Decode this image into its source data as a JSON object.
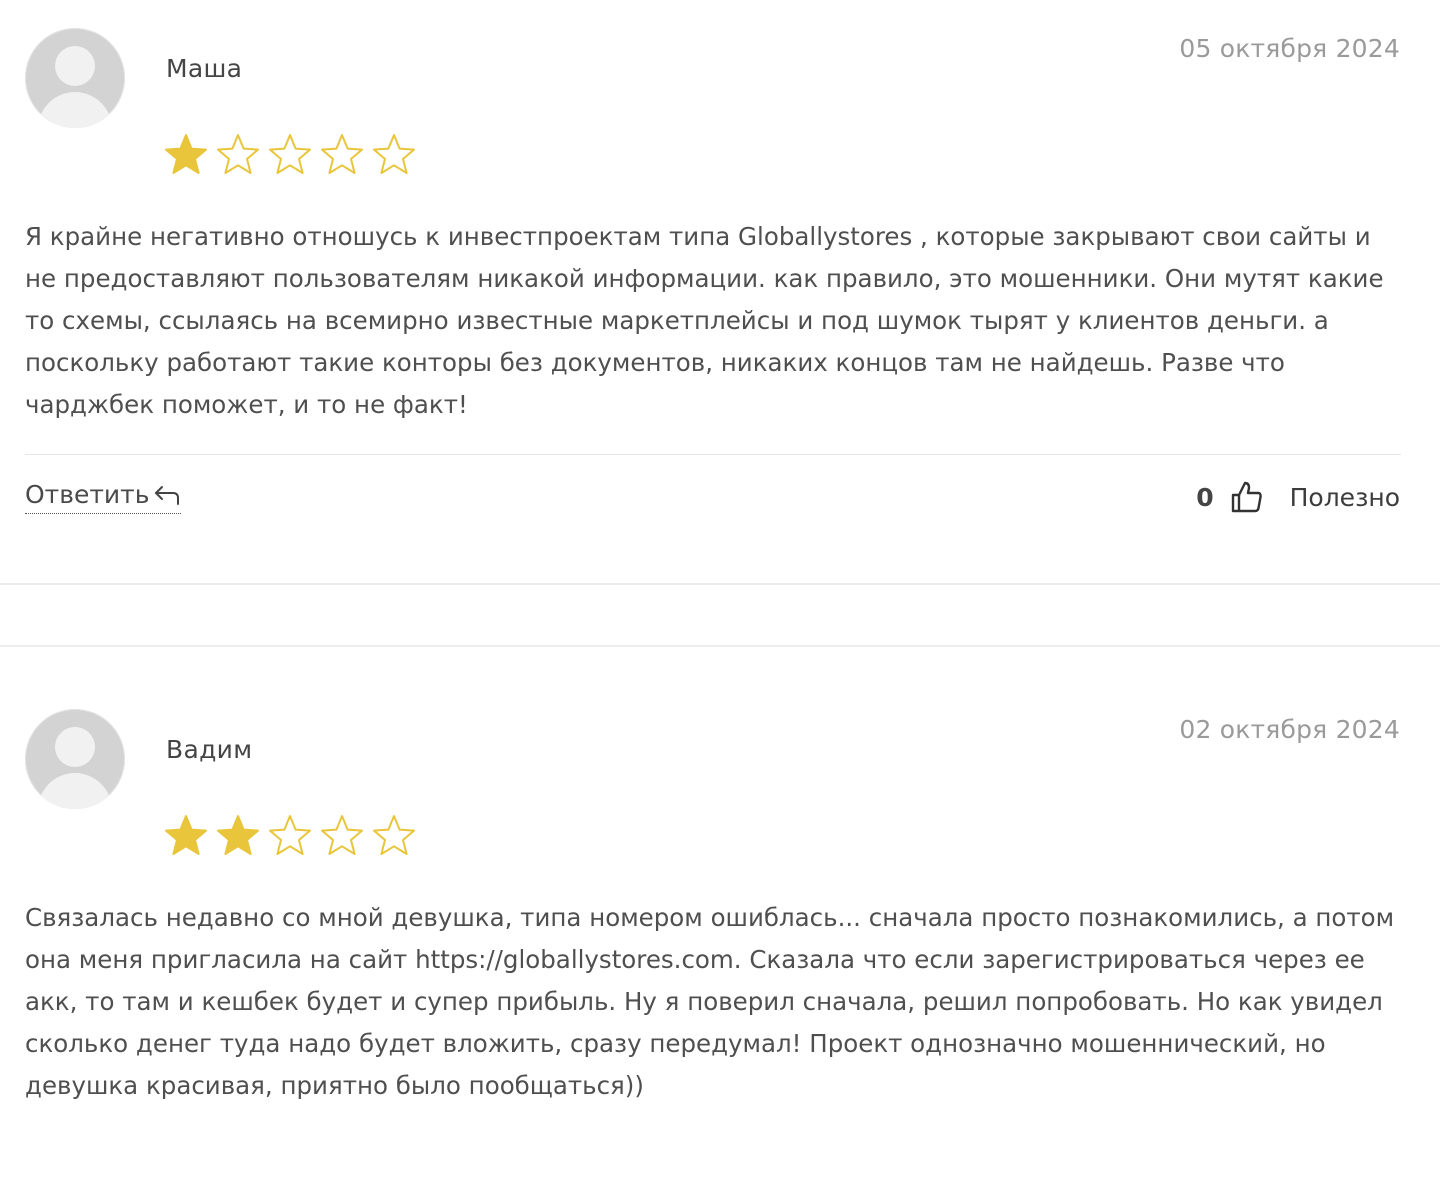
{
  "reviews": [
    {
      "author": "Маша",
      "date": "05 октября 2024",
      "rating": 1,
      "rating_max": 5,
      "text": "Я крайне негативно отношусь к инвестпроектам типа Globallystores , которые закрывают свои сайты и не предоставляют пользователям никакой информации. как правило, это мошенники. Они мутят какие то схемы, ссылаясь на всемирно известные маркетплейсы и под шумок тырят у клиентов деньги. а поскольку работают такие конторы без документов, никаких концов там не найдешь. Разве что чарджбек поможет, и то не факт!",
      "reply_label": "Ответить",
      "helpful_count": "0",
      "helpful_label": "Полезно"
    },
    {
      "author": "Вадим",
      "date": "02 октября 2024",
      "rating": 2,
      "rating_max": 5,
      "text": "Связалась недавно со мной девушка, типа номером ошиблась... сначала просто познакомились, а потом она меня пригласила на сайт https://globallystores.com. Сказала что если зарегистрироваться через ее акк, то там и кешбек будет и супер прибыль. Ну я поверил сначала, решил попробовать. Но как увидел сколько денег туда надо будет вложить, сразу передумал! Проект однозначно мошеннический, но девушка красивая, приятно было пообщаться))"
    }
  ],
  "icons": {
    "avatar": "user-placeholder-icon",
    "star": "star-icon",
    "reply": "reply-arrow-icon",
    "like": "thumbs-up-icon"
  },
  "colors": {
    "star_filled": "#e8c53a",
    "star_outline": "#e8c53a",
    "date": "#9a9a9a",
    "divider": "#e6e6e6"
  }
}
